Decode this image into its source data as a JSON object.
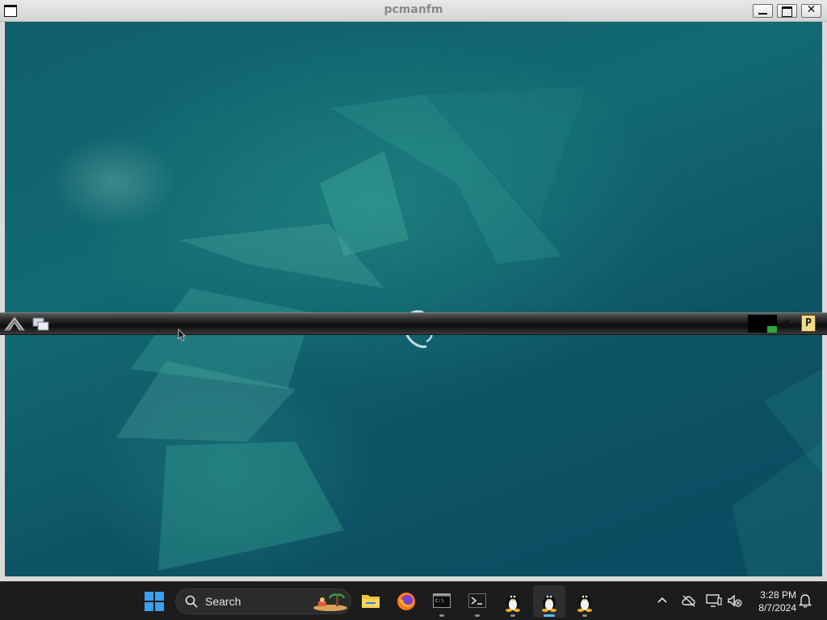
{
  "window": {
    "title": "pcmanfm",
    "menu_icon": "window-menu-icon",
    "buttons": [
      "minimize-icon",
      "maximize-icon",
      "close-icon"
    ],
    "close_glyph": "✕"
  },
  "lxde_panel": {
    "menu_icon": "lxde-menu-icon",
    "show_desktop_icon": "show-desktop-icon",
    "clipboard_label": "P"
  },
  "taskbar": {
    "search_placeholder": "Search",
    "apps": [
      "windows-start-icon",
      "file-explorer-icon",
      "firefox-icon",
      "terminal-icon",
      "powershell-icon",
      "tux-icon",
      "tux-icon",
      "tux-icon"
    ],
    "tray_icons": [
      "chevron-up-icon",
      "cloud-off-icon",
      "display-icon",
      "speaker-muted-icon",
      "notification-bell-icon"
    ],
    "clock": {
      "time": "3:28 PM",
      "date": "8/7/2024"
    }
  },
  "colors": {
    "wallpaper": "#0f5f6c",
    "taskbar": "#1c1c1c",
    "accent": "#4cc2ff"
  }
}
